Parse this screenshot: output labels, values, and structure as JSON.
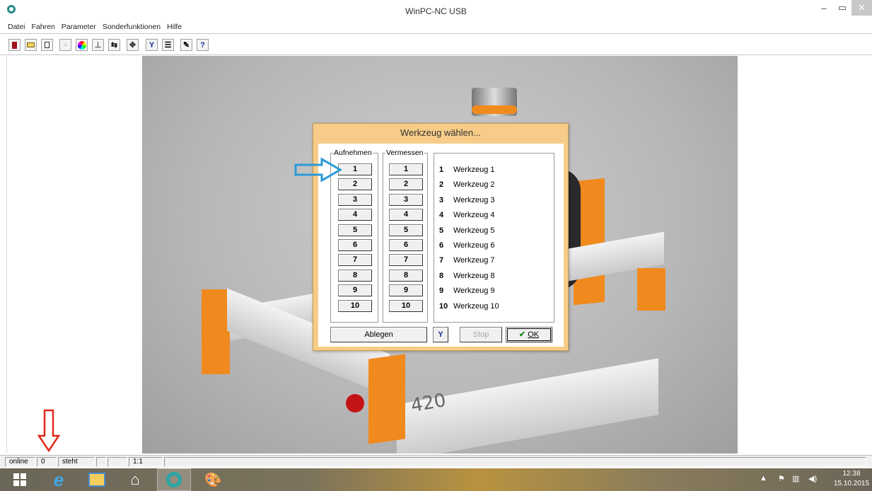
{
  "window": {
    "title": "WinPC-NC USB",
    "min_icon": "minimize-icon",
    "max_icon": "maximize-icon",
    "close_icon": "close-icon"
  },
  "menu": [
    "Datei",
    "Fahren",
    "Parameter",
    "Sonderfunktionen",
    "Hilfe"
  ],
  "toolbar": {
    "buttons": [
      "exit-icon",
      "open-folder-icon",
      "file-icon",
      "points-icon",
      "color-wheel-icon",
      "anchor-icon",
      "transfer-icon",
      "move-icon",
      "wrench-icon",
      "list-icon",
      "pen-icon",
      "help-icon"
    ],
    "help_glyph": "?"
  },
  "dialog": {
    "title": "Werkzeug wählen...",
    "group_pick": "Aufnehmen",
    "group_measure": "Vermessen",
    "numbers": [
      "1",
      "2",
      "3",
      "4",
      "5",
      "6",
      "7",
      "8",
      "9",
      "10"
    ],
    "tools": [
      {
        "n": "1",
        "name": "Werkzeug 1"
      },
      {
        "n": "2",
        "name": "Werkzeug 2"
      },
      {
        "n": "3",
        "name": "Werkzeug 3"
      },
      {
        "n": "4",
        "name": "Werkzeug 4"
      },
      {
        "n": "5",
        "name": "Werkzeug 5"
      },
      {
        "n": "6",
        "name": "Werkzeug 6"
      },
      {
        "n": "7",
        "name": "Werkzeug 7"
      },
      {
        "n": "8",
        "name": "Werkzeug 8"
      },
      {
        "n": "9",
        "name": "Werkzeug 9"
      },
      {
        "n": "10",
        "name": "Werkzeug 10"
      }
    ],
    "ablegen": "Ablegen",
    "stop": "Stop",
    "ok": "OK",
    "ok_check": "✔"
  },
  "machine": {
    "label": "420"
  },
  "status": {
    "online": "online",
    "tool": "0",
    "state": "steht",
    "scale": "1:1"
  },
  "taskbar": {
    "items": [
      "start-icon",
      "internet-explorer-icon",
      "file-explorer-icon",
      "home-icon",
      "winpc-nc-icon",
      "paint-icon"
    ],
    "time": "12:38",
    "date": "15.10.2015"
  },
  "colors": {
    "dialog_frame": "#f6cc88",
    "machine_orange": "#f08a1e",
    "annotation_blue": "#2a9ad8",
    "annotation_red": "#e0291c"
  }
}
